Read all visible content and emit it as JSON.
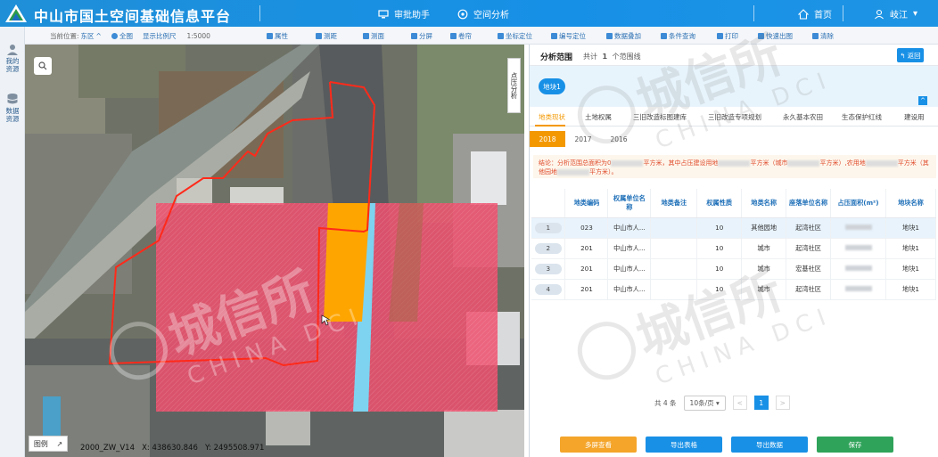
{
  "header": {
    "app_title": "中山市国土空间基础信息平台",
    "nav": [
      {
        "label": "审批助手",
        "icon": "monitor-icon"
      },
      {
        "label": "空间分析",
        "icon": "aperture-icon"
      }
    ],
    "home_label": "首页",
    "user_label": "岐江"
  },
  "toolbar": {
    "location_label": "当前位置:",
    "location_value": "东区",
    "full_map": "全图",
    "scale_label": "显示比例尺",
    "scale_value": "1:5000",
    "tools": [
      "属性",
      "测距",
      "测面",
      "分屏",
      "卷帘",
      "坐标定位",
      "编号定位",
      "数据叠加",
      "条件查询",
      "打印",
      "快速出图",
      "清除"
    ]
  },
  "left_rail": {
    "items": [
      "我的资源",
      "数据资源"
    ]
  },
  "map": {
    "side_tab": "点压分析",
    "legend_label": "图例",
    "coords": "2000_ZW_V14   X: 438630.846   Y: 2495508.971"
  },
  "panel": {
    "title": "分析范围",
    "count_prefix": "共计",
    "count_value": "1",
    "count_suffix": "个范围线",
    "back_label": "返回",
    "parcel_label": "地块1",
    "tabs": [
      "地类现状",
      "土地权属",
      "三旧改造标图建库",
      "三旧改造专项规划",
      "永久基本农田",
      "生态保护红线",
      "建设用"
    ],
    "active_tab": 0,
    "years": [
      "2018",
      "2017",
      "2016"
    ],
    "active_year": 0,
    "conclusion_parts": [
      "结论：分析范围总面积为0",
      "平方米，其中占压建设用地",
      "平方米（城市",
      "平方米）,农用地",
      "平方米（其他园地",
      "平方米）。"
    ],
    "table": {
      "headers": [
        "",
        "地类编码",
        "权属单位名称",
        "地类备注",
        "权属性质",
        "地类名称",
        "座落单位名称",
        "占压面积(m²)",
        "地块名称"
      ],
      "rows": [
        [
          "1",
          "023",
          "中山市人...",
          "",
          "10",
          "其他园地",
          "起湾社区",
          "",
          "地块1"
        ],
        [
          "2",
          "201",
          "中山市人...",
          "",
          "10",
          "城市",
          "起湾社区",
          "",
          "地块1"
        ],
        [
          "3",
          "201",
          "中山市人...",
          "",
          "10",
          "城市",
          "宏基社区",
          "",
          "地块1"
        ],
        [
          "4",
          "201",
          "中山市人...",
          "",
          "10",
          "城市",
          "起湾社区",
          "",
          "地块1"
        ]
      ]
    },
    "pager": {
      "total": "共 4 条",
      "page_size": "10条/页",
      "prev": "<",
      "current": "1",
      "next": ">"
    },
    "actions": [
      {
        "label": "多屏查看",
        "color": "#f4a52a"
      },
      {
        "label": "导出表格",
        "color": "#1890e6"
      },
      {
        "label": "导出数据",
        "color": "#1890e6"
      },
      {
        "label": "保存",
        "color": "#2fa35a"
      }
    ]
  },
  "watermark": {
    "cn": "城信所",
    "en": "CHINA DCI"
  },
  "colors": {
    "header": "#1890e6",
    "accent": "#f39800",
    "overlay_red": "#f0506e",
    "overlay_orange": "#ffa500",
    "overlay_cyan": "#7dd3f0"
  }
}
